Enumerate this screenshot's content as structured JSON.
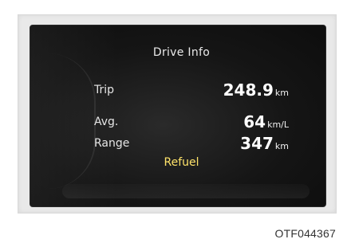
{
  "display": {
    "title": "Drive Info",
    "rows": [
      {
        "label": "Trip",
        "value": "248.9",
        "unit": "km"
      },
      {
        "label": "Avg.",
        "value": "64",
        "unit": "km/L"
      },
      {
        "label": "Range",
        "value": "347",
        "unit": "km"
      }
    ],
    "status": "Refuel"
  },
  "figure": {
    "code": "OTF044367"
  },
  "colors": {
    "screen": "#141414",
    "text": "#ffffff",
    "status": "#ffe36a"
  }
}
